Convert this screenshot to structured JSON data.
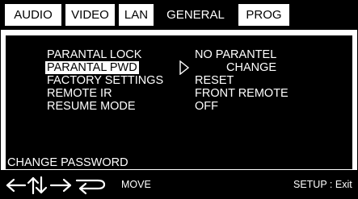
{
  "tabs": [
    {
      "label": "AUDIO",
      "active": false
    },
    {
      "label": "VIDEO",
      "active": false
    },
    {
      "label": "LAN",
      "active": false
    },
    {
      "label": "GENERAL",
      "active": true
    },
    {
      "label": "PROG",
      "active": false
    }
  ],
  "menu": {
    "items": [
      {
        "label": "PARANTAL LOCK",
        "value": "NO PARANTEL"
      },
      {
        "label": "PARANTAL PWD",
        "value": "CHANGE",
        "selected": true
      },
      {
        "label": "FACTORY SETTINGS",
        "value": "RESET"
      },
      {
        "label": "REMOTE IR",
        "value": "FRONT REMOTE"
      },
      {
        "label": "RESUME MODE",
        "value": "OFF"
      }
    ],
    "hint": "CHANGE PASSWORD"
  },
  "footer": {
    "nav_icons": [
      "arrow-left-icon",
      "arrow-up-icon",
      "arrow-down-icon",
      "arrow-right-icon",
      "return-icon"
    ],
    "move_label": "MOVE",
    "setup_label": "SETUP : Exit"
  }
}
